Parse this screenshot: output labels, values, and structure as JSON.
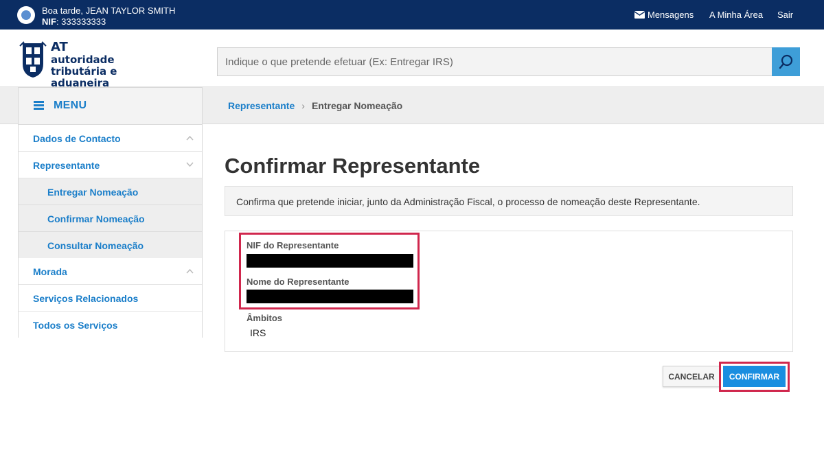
{
  "topbar": {
    "greeting": "Boa tarde, JEAN TAYLOR SMITH",
    "nif_label": "NIF",
    "nif_value": ": 333333333",
    "links": {
      "messages": "Mensagens",
      "my_area": "A Minha Área",
      "logout": "Sair"
    }
  },
  "logo": {
    "abbr": "AT",
    "line1": "autoridade",
    "line2": "tributária e aduaneira"
  },
  "search": {
    "placeholder": "Indique o que pretende efetuar (Ex: Entregar IRS)",
    "icon": "search-icon"
  },
  "sidebar": {
    "menu_label": "MENU",
    "items": [
      {
        "label": "Dados de Contacto",
        "expanded": false
      },
      {
        "label": "Representante",
        "expanded": true
      },
      {
        "label": "Entregar Nomeação",
        "sub": true
      },
      {
        "label": "Confirmar Nomeação",
        "sub": true
      },
      {
        "label": "Consultar Nomeação",
        "sub": true
      },
      {
        "label": "Morada",
        "expanded": false
      },
      {
        "label": "Serviços Relacionados"
      },
      {
        "label": "Todos os Serviços"
      }
    ]
  },
  "breadcrumb": {
    "parent": "Representante",
    "current": "Entregar Nomeação"
  },
  "main": {
    "title": "Confirmar Representante",
    "info": "Confirma que pretende iniciar, junto da Administração Fiscal, o processo de nomeação deste Representante.",
    "fields": {
      "nif_label": "NIF do Representante",
      "name_label": "Nome do Representante",
      "scope_label": "Âmbitos",
      "scope_value": "IRS"
    },
    "buttons": {
      "cancel": "CANCELAR",
      "confirm": "CONFIRMAR"
    }
  },
  "colors": {
    "topbar": "#0b2d63",
    "link": "#1a7ec9",
    "primary_button": "#1a8ee0",
    "highlight": "#d0274d"
  }
}
